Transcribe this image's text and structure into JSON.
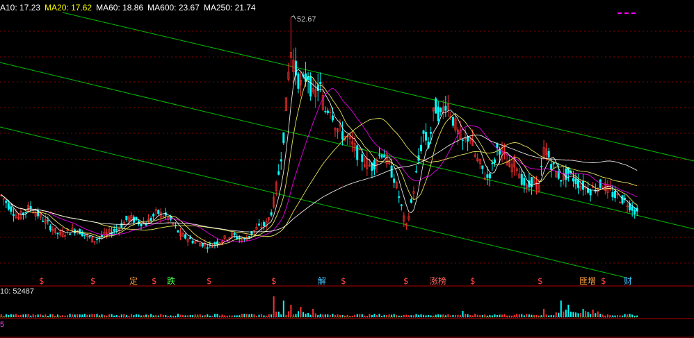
{
  "header": {
    "ma_labels": [
      {
        "name": "ma10",
        "text": "A10: 17.23",
        "color": "#ffffff"
      },
      {
        "name": "ma20",
        "text": "MA20: 17.62",
        "color": "#ffff00"
      },
      {
        "name": "ma60",
        "text": "MA60: 18.86",
        "color": "#ffffff"
      },
      {
        "name": "ma600",
        "text": "MA600: 23.67",
        "color": "#ffffff"
      },
      {
        "name": "ma250",
        "text": "MA250: 21.74",
        "color": "#ffffff"
      }
    ]
  },
  "price_max_label": "52.67",
  "volume_header": "10: 52487",
  "indicator_header": "5",
  "event_markers": [
    {
      "text": "$",
      "color": "#ff4040"
    },
    {
      "text": "$",
      "color": "#ff4040"
    },
    {
      "text": "定",
      "color": "#ffa040"
    },
    {
      "text": "$",
      "color": "#ff4040"
    },
    {
      "text": "跌",
      "color": "#40ff40"
    },
    {
      "text": "$",
      "color": "#ff4040"
    },
    {
      "text": "$",
      "color": "#ff4040"
    },
    {
      "text": "解",
      "color": "#40c0ff"
    },
    {
      "text": "$",
      "color": "#ff4040"
    },
    {
      "text": "$",
      "color": "#ff4040"
    },
    {
      "text": "涨榜",
      "color": "#ff6060"
    },
    {
      "text": "$",
      "color": "#ff4040"
    },
    {
      "text": "$",
      "color": "#ff4040"
    },
    {
      "text": "匪增",
      "color": "#ffa040"
    },
    {
      "text": "$",
      "color": "#ff4040"
    },
    {
      "text": "财",
      "color": "#40c0ff"
    }
  ],
  "colors": {
    "background": "#000000",
    "grid": "#8b0000",
    "channel": "#00c000",
    "up_candle": "#ff3030",
    "down_candle": "#00ffff",
    "ma_white": "#ffffff",
    "ma_yellow": "#ffff66",
    "ma_pink": "#ff00ff",
    "volume": "#00ffff"
  },
  "chart_data": {
    "type": "candlestick",
    "title": "",
    "ylim": [
      8,
      54
    ],
    "max_price": 52.67,
    "price_path": [
      [
        0,
        21
      ],
      [
        3,
        17
      ],
      [
        5,
        19
      ],
      [
        8,
        16
      ],
      [
        10,
        14
      ],
      [
        13,
        15
      ],
      [
        16,
        13
      ],
      [
        18,
        14
      ],
      [
        20,
        15
      ],
      [
        22,
        17
      ],
      [
        25,
        16
      ],
      [
        27,
        18
      ],
      [
        29,
        17
      ],
      [
        31,
        14
      ],
      [
        33,
        13
      ],
      [
        36,
        12
      ],
      [
        38,
        13
      ],
      [
        40,
        14
      ],
      [
        42,
        13
      ],
      [
        44,
        15
      ],
      [
        46,
        16
      ],
      [
        47,
        19
      ],
      [
        48,
        25
      ],
      [
        49,
        33
      ],
      [
        50,
        47
      ],
      [
        51,
        43
      ],
      [
        52,
        40
      ],
      [
        53,
        43
      ],
      [
        54,
        38
      ],
      [
        55,
        41
      ],
      [
        56,
        36
      ],
      [
        57,
        37
      ],
      [
        58,
        33
      ],
      [
        60,
        31
      ],
      [
        62,
        28
      ],
      [
        64,
        26
      ],
      [
        66,
        29
      ],
      [
        68,
        24
      ],
      [
        69,
        20
      ],
      [
        70,
        15
      ],
      [
        71,
        20
      ],
      [
        72,
        26
      ],
      [
        73,
        32
      ],
      [
        74,
        30
      ],
      [
        75,
        37
      ],
      [
        76,
        35
      ],
      [
        77,
        38
      ],
      [
        78,
        35
      ],
      [
        79,
        32
      ],
      [
        80,
        30
      ],
      [
        81,
        32
      ],
      [
        82,
        28
      ],
      [
        83,
        26
      ],
      [
        84,
        24
      ],
      [
        85,
        26
      ],
      [
        86,
        30
      ],
      [
        87,
        28
      ],
      [
        88,
        26
      ],
      [
        89,
        27
      ],
      [
        90,
        24
      ],
      [
        91,
        22
      ],
      [
        92,
        24
      ],
      [
        93,
        22
      ],
      [
        94,
        30
      ],
      [
        95,
        27
      ],
      [
        96,
        25
      ],
      [
        97,
        24
      ],
      [
        98,
        25
      ],
      [
        100,
        23
      ],
      [
        102,
        22
      ],
      [
        104,
        23
      ],
      [
        106,
        21
      ],
      [
        108,
        20
      ],
      [
        110,
        18
      ]
    ],
    "volume_spikes": [
      [
        47,
        1
      ],
      [
        49,
        0.8
      ],
      [
        50,
        0.6
      ],
      [
        52,
        0.5
      ],
      [
        54,
        0.4
      ],
      [
        80,
        0.3
      ],
      [
        94,
        0.4
      ],
      [
        97,
        0.8
      ],
      [
        98,
        0.6
      ]
    ],
    "channel_lines": "three parallel descending green trend lines"
  }
}
